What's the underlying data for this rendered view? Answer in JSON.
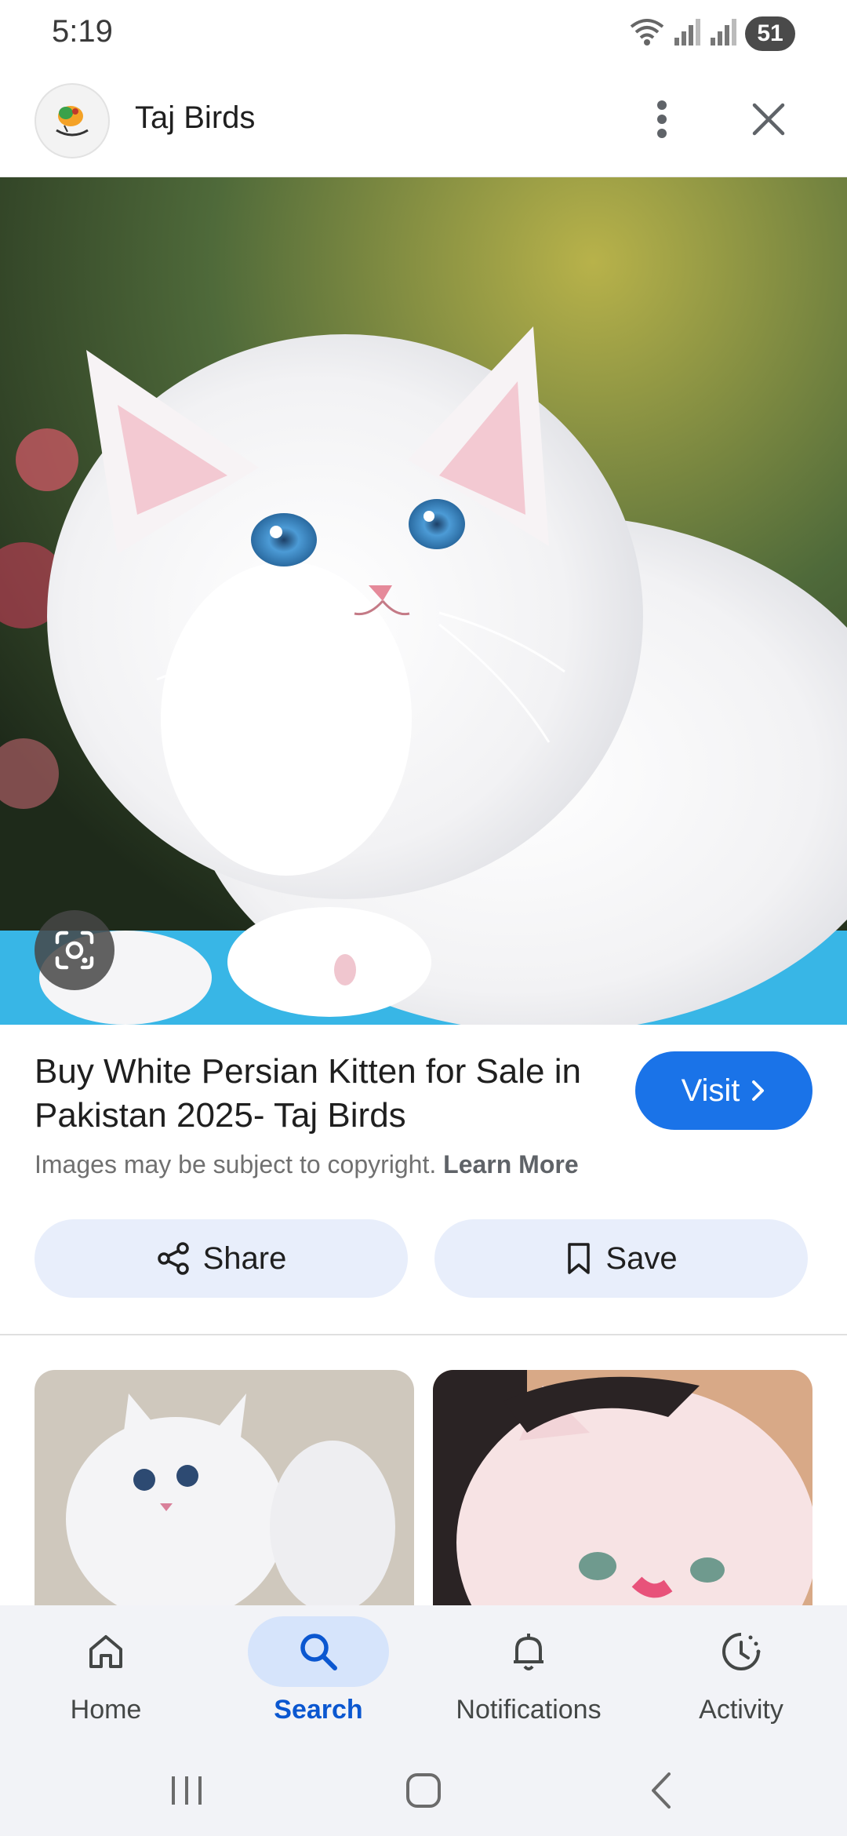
{
  "status_bar": {
    "time": "5:19",
    "battery": "51"
  },
  "header": {
    "site_name": "Taj Birds",
    "more_icon": "more-vert-icon",
    "close_icon": "close-icon"
  },
  "result": {
    "title": "Buy White Persian Kitten for Sale in Pakistan 2025- Taj Birds",
    "visit_label": "Visit",
    "copyright_text": "Images may be subject to copyright.",
    "learn_more_label": "Learn More"
  },
  "actions": {
    "share_label": "Share",
    "save_label": "Save"
  },
  "bottom_nav": {
    "items": [
      {
        "label": "Home",
        "icon": "home-icon",
        "active": false
      },
      {
        "label": "Search",
        "icon": "search-icon",
        "active": true
      },
      {
        "label": "Notifications",
        "icon": "bell-icon",
        "active": false
      },
      {
        "label": "Activity",
        "icon": "activity-icon",
        "active": false
      }
    ]
  },
  "colors": {
    "accent": "#1a73e8",
    "active_nav": "#0b57d0",
    "chip_bg": "#e8eefb"
  }
}
